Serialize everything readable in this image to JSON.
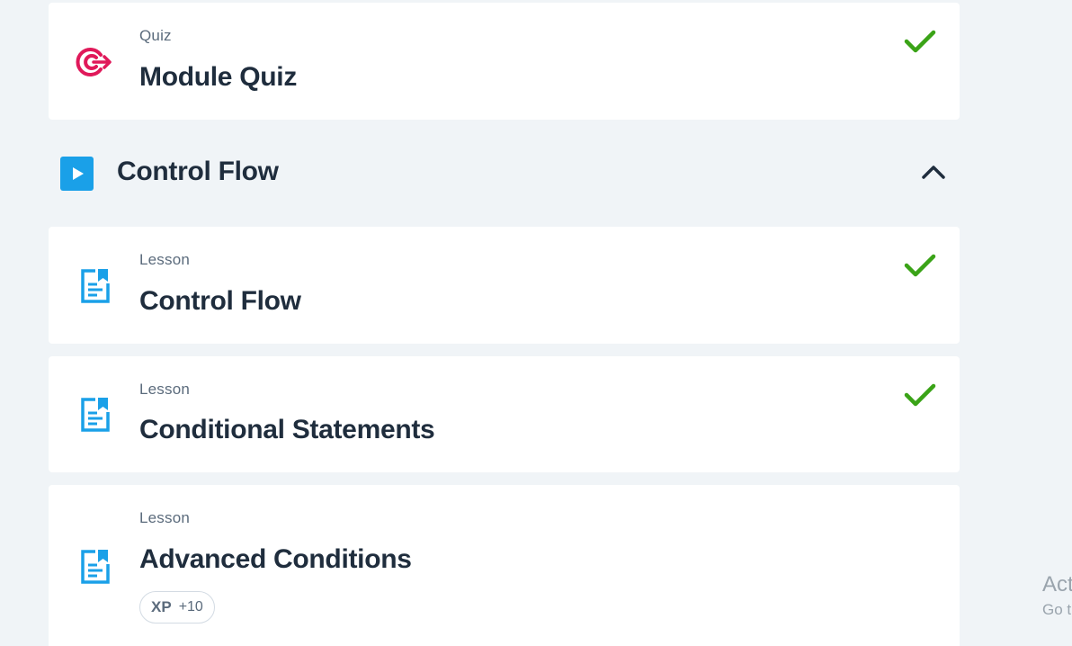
{
  "quiz_card": {
    "type": "Quiz",
    "title": "Module Quiz",
    "icon": "target-icon",
    "completed": true
  },
  "section": {
    "title": "Control Flow",
    "icon": "play-icon",
    "expanded": true
  },
  "lessons": [
    {
      "type": "Lesson",
      "title": "Control Flow",
      "icon": "document-icon",
      "completed": true
    },
    {
      "type": "Lesson",
      "title": "Conditional Statements",
      "icon": "document-icon",
      "completed": true
    },
    {
      "type": "Lesson",
      "title": "Advanced Conditions",
      "icon": "document-icon",
      "completed": false,
      "xp_label": "XP",
      "xp_value": "+10"
    }
  ],
  "watermark": {
    "line1": "Act",
    "line2": "Go t"
  },
  "colors": {
    "accent": "#1aa0e8",
    "check": "#3aa317",
    "quiz_icon": "#e0195a",
    "background": "#f0f4f7"
  }
}
